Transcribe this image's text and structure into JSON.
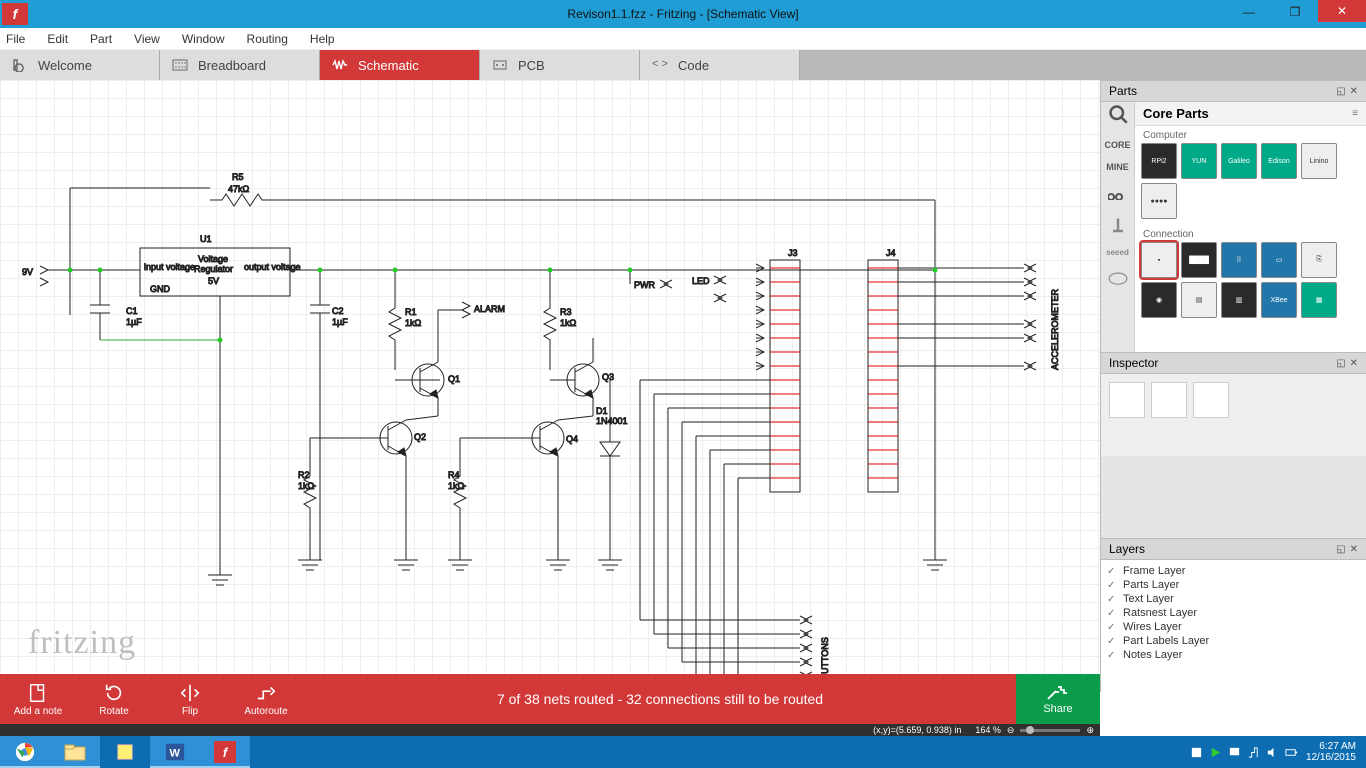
{
  "title": "Revison1.1.fzz - Fritzing - [Schematic View]",
  "menu": [
    "File",
    "Edit",
    "Part",
    "View",
    "Window",
    "Routing",
    "Help"
  ],
  "tabs": {
    "welcome": "Welcome",
    "breadboard": "Breadboard",
    "schematic": "Schematic",
    "pcb": "PCB",
    "code": "Code"
  },
  "watermark": "fritzing",
  "actionbar": {
    "addnote": "Add a note",
    "rotate": "Rotate",
    "flip": "Flip",
    "autoroute": "Autoroute",
    "status": "7 of 38 nets routed - 32 connections still to be routed",
    "share": "Share"
  },
  "statusbar": {
    "coords": "(x,y)=(5.659, 0.938) in",
    "zoom": "164 %"
  },
  "parts": {
    "title": "Parts",
    "bin": "Core Parts",
    "side": [
      "CORE",
      "MINE"
    ],
    "sections": [
      "Computer",
      "Connection"
    ],
    "computer_items": [
      "RPi2",
      "YUN",
      "Galileo",
      "Edison",
      "Linino"
    ],
    "conn_items": [
      "",
      "",
      "",
      "",
      "",
      "",
      "",
      "",
      "",
      ""
    ]
  },
  "inspector": {
    "title": "Inspector"
  },
  "layers": {
    "title": "Layers",
    "items": [
      "Frame Layer",
      "Parts Layer",
      "Text Layer",
      "Ratsnest Layer",
      "Wires Layer",
      "Part Labels Layer",
      "Notes Layer"
    ]
  },
  "taskbar": {
    "time": "6:27 AM",
    "date": "12/16/2015"
  },
  "schem": {
    "labels": {
      "nineV": "9V",
      "R5": "R5",
      "R5v": "47kΩ",
      "U1": "U1",
      "VR1": "Voltage",
      "VR2": "Regulator",
      "VR3": "5V",
      "VRin": "input voltage",
      "VRout": "output voltage",
      "VRgnd": "GND",
      "C1": "C1",
      "C1v": "1µF",
      "C2": "C2",
      "C2v": "1µF",
      "R1": "R1",
      "R1v": "1kΩ",
      "R2": "R2",
      "R2v": "1kΩ",
      "R3": "R3",
      "R3v": "1kΩ",
      "R4": "R4",
      "R4v": "1kΩ",
      "Q1": "Q1",
      "Q2": "Q2",
      "Q3": "Q3",
      "Q4": "Q4",
      "D1": "D1",
      "D1v": "1N4001",
      "ALARM": "ALARM",
      "PWR": "PWR",
      "LED": "LED",
      "BUTTONS": "BUTTONS",
      "ACCEL": "ACCELEROMETER",
      "J3": "J3",
      "J4": "J4"
    }
  }
}
